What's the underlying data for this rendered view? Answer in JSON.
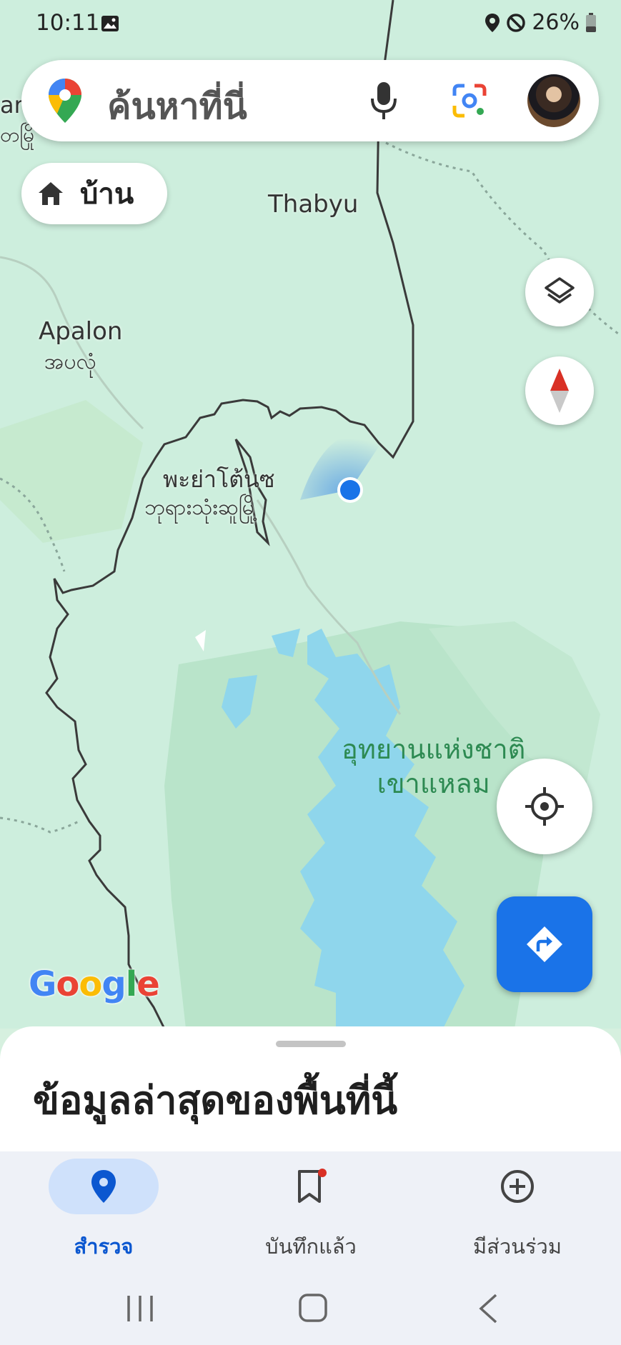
{
  "status": {
    "time": "10:11",
    "battery": "26%"
  },
  "search": {
    "placeholder": "ค้นหาที่นี่"
  },
  "home_chip": {
    "label": "บ้าน"
  },
  "map": {
    "labels": {
      "thabyu": "Thabyu",
      "apalon_en": "Apalon",
      "apalon_my": "အပလုံ",
      "pagoda_th": "พะย่าโต้นซ",
      "pagoda_my": "ဘုရားသုံးဆူမြို့",
      "park_line1": "อุทยานแห่งชาติ",
      "park_line2": "เขาแหลม",
      "edge_top_left_1": "ar",
      "edge_top_left_2": "တမြို"
    },
    "attribution": "Google",
    "colors": {
      "land": "#cdeedd",
      "forest": "#b7e3c8",
      "water": "#8fd6ec",
      "border": "#3a3a3a",
      "location": "#1a73e8"
    }
  },
  "sheet": {
    "title": "ข้อมูลล่าสุดของพื้นที่นี้"
  },
  "nav": {
    "explore": "สำรวจ",
    "saved": "บันทึกแล้ว",
    "contribute": "มีส่วนร่วม"
  },
  "icons": [
    "gallery-icon",
    "location-status-icon",
    "dnd-icon",
    "battery-icon",
    "maps-pin-icon",
    "mic-icon",
    "lens-icon",
    "home-icon",
    "layers-icon",
    "compass-icon",
    "my-location-icon",
    "directions-icon",
    "explore-icon",
    "saved-icon",
    "contribute-icon",
    "recents-icon",
    "home-nav-icon",
    "back-icon"
  ]
}
